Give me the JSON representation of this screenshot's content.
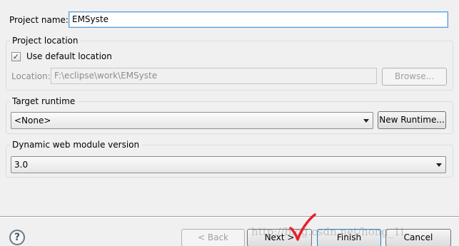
{
  "project_name": {
    "label": "Project name:",
    "value": "EMSyste"
  },
  "project_location": {
    "group_title": "Project location",
    "use_default_label": "Use default location",
    "use_default_checked": true,
    "location_label": "Location:",
    "location_value": "F:\\eclipse\\work\\EMSyste",
    "browse_label": "Browse..."
  },
  "target_runtime": {
    "group_title": "Target runtime",
    "selected": "<None>",
    "new_runtime_label": "New Runtime..."
  },
  "web_module": {
    "group_title": "Dynamic web module version",
    "selected": "3.0"
  },
  "footer": {
    "help_glyph": "?",
    "back_label": "< Back",
    "next_label": "Next >",
    "finish_label": "Finish",
    "cancel_label": "Cancel"
  },
  "overlay": {
    "watermark_text": "http://blog.csdn.net/hong_1i",
    "checkmark_color": "#e8202a"
  }
}
